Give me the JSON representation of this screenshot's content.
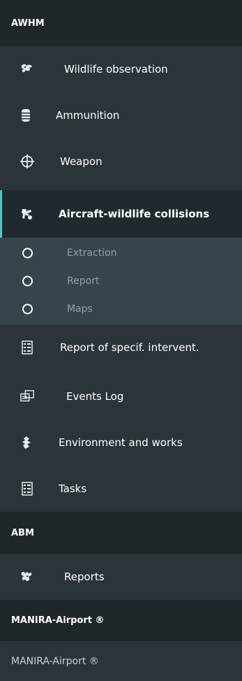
{
  "sections": {
    "awhm": {
      "title": "AWHM"
    },
    "abm": {
      "title": "ABM"
    },
    "manira": {
      "title": "MANIRA-Airport ®"
    }
  },
  "awhm_items": [
    {
      "label": "Wildlife observation",
      "icon": "wildlife-icon"
    },
    {
      "label": "Ammunition",
      "icon": "ammunition-icon"
    },
    {
      "label": "Weapon",
      "icon": "crosshair-icon"
    },
    {
      "label": "Aircraft-wildlife collisions",
      "icon": "collision-icon",
      "active": true
    },
    {
      "label": "Report of specif. intervent.",
      "icon": "report-icon"
    },
    {
      "label": "Events Log",
      "icon": "events-log-icon"
    },
    {
      "label": "Environment and works",
      "icon": "environment-icon"
    },
    {
      "label": "Tasks",
      "icon": "tasks-icon"
    }
  ],
  "collision_submenu": [
    {
      "label": "Extraction"
    },
    {
      "label": "Report"
    },
    {
      "label": "Maps"
    }
  ],
  "abm_items": [
    {
      "label": "Reports",
      "icon": "reports-icon"
    }
  ],
  "manira_items": [
    {
      "label": "MANIRA-Airport ®"
    }
  ],
  "colors": {
    "sidebar_bg": "#2b3439",
    "header_bg": "#1f272b",
    "active_bg": "#202a2e",
    "accent": "#58c2c9",
    "submenu_bg": "#36454a",
    "submenu_text": "#8ea2a8"
  }
}
